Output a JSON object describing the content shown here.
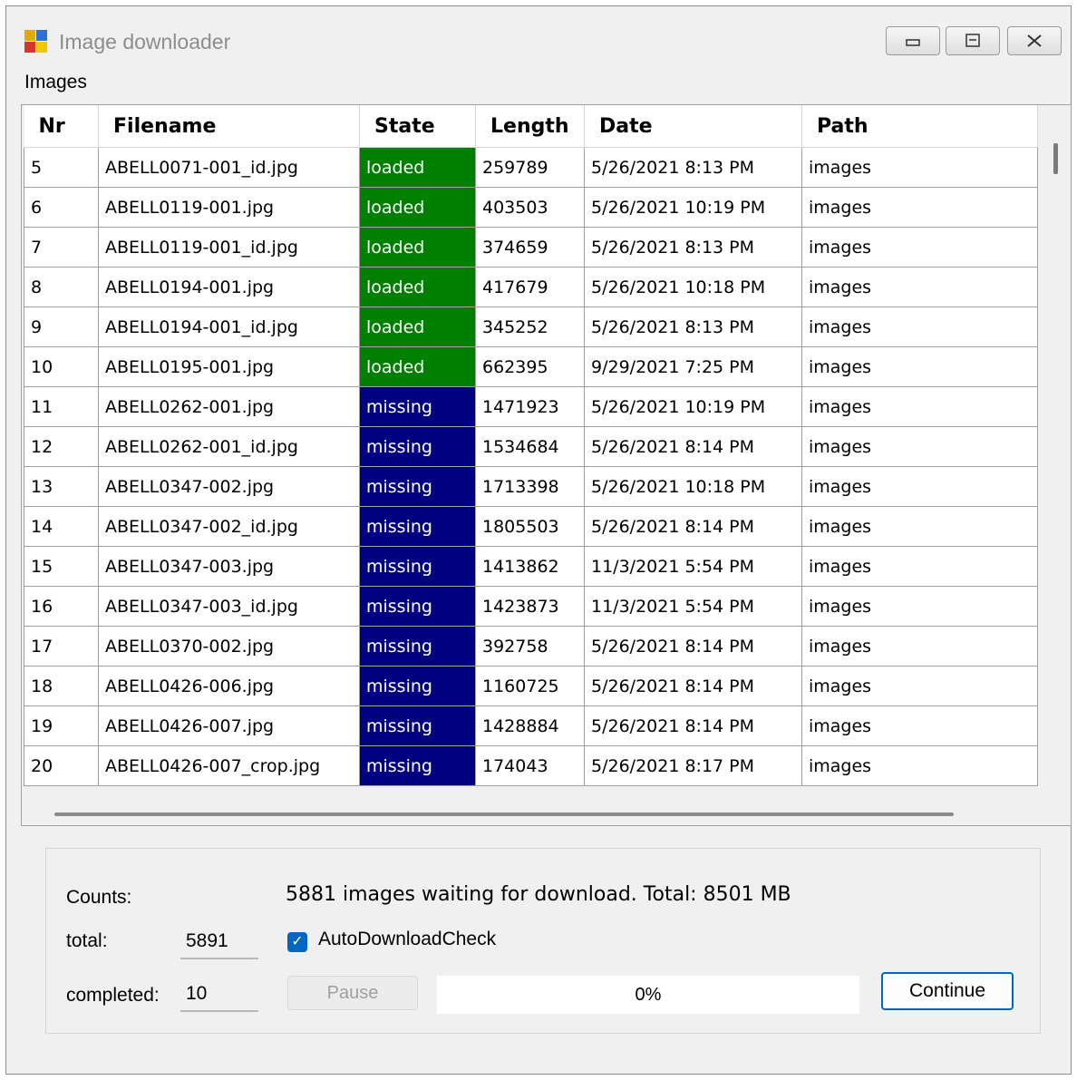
{
  "window": {
    "title": "Image downloader",
    "controls": [
      "minimize-icon",
      "maximize-icon",
      "close-icon"
    ]
  },
  "menu": {
    "images_label": "Images"
  },
  "grid": {
    "columns": [
      "Nr",
      "Filename",
      "State",
      "Length",
      "Date",
      "Path"
    ],
    "rows": [
      {
        "nr": "5",
        "filename": "ABELL0071-001_id.jpg",
        "state": "loaded",
        "length": "259789",
        "date": "5/26/2021 8:13 PM",
        "path": "images"
      },
      {
        "nr": "6",
        "filename": "ABELL0119-001.jpg",
        "state": "loaded",
        "length": "403503",
        "date": "5/26/2021 10:19 PM",
        "path": "images"
      },
      {
        "nr": "7",
        "filename": "ABELL0119-001_id.jpg",
        "state": "loaded",
        "length": "374659",
        "date": "5/26/2021 8:13 PM",
        "path": "images"
      },
      {
        "nr": "8",
        "filename": "ABELL0194-001.jpg",
        "state": "loaded",
        "length": "417679",
        "date": "5/26/2021 10:18 PM",
        "path": "images"
      },
      {
        "nr": "9",
        "filename": "ABELL0194-001_id.jpg",
        "state": "loaded",
        "length": "345252",
        "date": "5/26/2021 8:13 PM",
        "path": "images"
      },
      {
        "nr": "10",
        "filename": "ABELL0195-001.jpg",
        "state": "loaded",
        "length": "662395",
        "date": "9/29/2021 7:25 PM",
        "path": "images"
      },
      {
        "nr": "11",
        "filename": "ABELL0262-001.jpg",
        "state": "missing",
        "length": "1471923",
        "date": "5/26/2021 10:19 PM",
        "path": "images"
      },
      {
        "nr": "12",
        "filename": "ABELL0262-001_id.jpg",
        "state": "missing",
        "length": "1534684",
        "date": "5/26/2021 8:14 PM",
        "path": "images"
      },
      {
        "nr": "13",
        "filename": "ABELL0347-002.jpg",
        "state": "missing",
        "length": "1713398",
        "date": "5/26/2021 10:18 PM",
        "path": "images"
      },
      {
        "nr": "14",
        "filename": "ABELL0347-002_id.jpg",
        "state": "missing",
        "length": "1805503",
        "date": "5/26/2021 8:14 PM",
        "path": "images"
      },
      {
        "nr": "15",
        "filename": "ABELL0347-003.jpg",
        "state": "missing",
        "length": "1413862",
        "date": "11/3/2021 5:54 PM",
        "path": "images"
      },
      {
        "nr": "16",
        "filename": "ABELL0347-003_id.jpg",
        "state": "missing",
        "length": "1423873",
        "date": "11/3/2021 5:54 PM",
        "path": "images"
      },
      {
        "nr": "17",
        "filename": "ABELL0370-002.jpg",
        "state": "missing",
        "length": "392758",
        "date": "5/26/2021 8:14 PM",
        "path": "images"
      },
      {
        "nr": "18",
        "filename": "ABELL0426-006.jpg",
        "state": "missing",
        "length": "1160725",
        "date": "5/26/2021 8:14 PM",
        "path": "images"
      },
      {
        "nr": "19",
        "filename": "ABELL0426-007.jpg",
        "state": "missing",
        "length": "1428884",
        "date": "5/26/2021 8:14 PM",
        "path": "images"
      },
      {
        "nr": "20",
        "filename": "ABELL0426-007_crop.jpg",
        "state": "missing",
        "length": "174043",
        "date": "5/26/2021 8:17 PM",
        "path": "images"
      }
    ]
  },
  "status": {
    "counts_label": "Counts:",
    "total_label": "total:",
    "total_value": "5891",
    "completed_label": "completed:",
    "completed_value": "10",
    "summary": "5881 images waiting for download. Total: 8501 MB",
    "auto_check_label": "AutoDownloadCheck",
    "auto_check_checked": true,
    "pause_label": "Pause",
    "progress_text": "0%",
    "progress_fraction": 0,
    "continue_label": "Continue"
  },
  "colors": {
    "loaded": "#008000",
    "missing": "#000080",
    "accent": "#0067c0"
  }
}
